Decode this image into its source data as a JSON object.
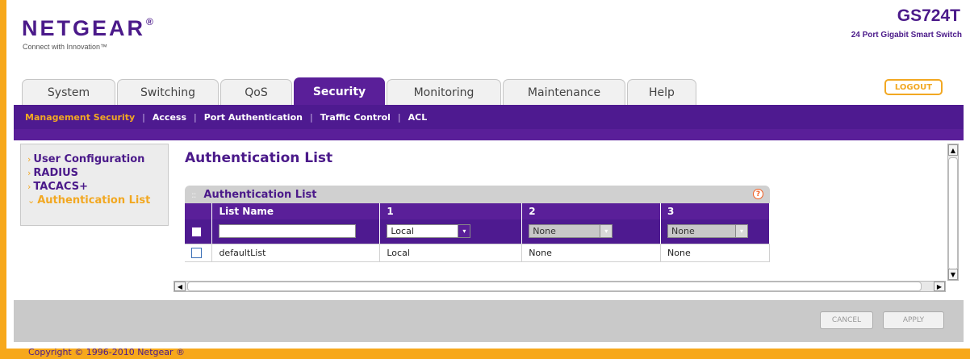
{
  "header": {
    "logo": "NETGEAR",
    "logo_mark": "®",
    "tagline": "Connect with Innovation™",
    "model": "GS724T",
    "model_desc": "24 Port Gigabit Smart Switch",
    "logout_label": "LOGOUT"
  },
  "tabs": [
    {
      "label": "System",
      "active": false
    },
    {
      "label": "Switching",
      "active": false
    },
    {
      "label": "QoS",
      "active": false
    },
    {
      "label": "Security",
      "active": true
    },
    {
      "label": "Monitoring",
      "active": false
    },
    {
      "label": "Maintenance",
      "active": false
    },
    {
      "label": "Help",
      "active": false
    }
  ],
  "subnav": [
    {
      "label": "Management Security",
      "active": true
    },
    {
      "label": "Access",
      "active": false
    },
    {
      "label": "Port Authentication",
      "active": false
    },
    {
      "label": "Traffic Control",
      "active": false
    },
    {
      "label": "ACL",
      "active": false
    }
  ],
  "sidebar": {
    "items": [
      {
        "label": "User Configuration",
        "active": false,
        "icon": "chevron-right-icon",
        "arrow": "›"
      },
      {
        "label": "RADIUS",
        "active": false,
        "icon": "chevron-right-icon",
        "arrow": "›"
      },
      {
        "label": "TACACS+",
        "active": false,
        "icon": "chevron-right-icon",
        "arrow": "›"
      },
      {
        "label": "Authentication List",
        "active": true,
        "icon": "chevron-down-icon",
        "arrow": "⌄"
      }
    ]
  },
  "main": {
    "page_title": "Authentication List",
    "panel_title": "Authentication List",
    "grip": "::",
    "help": "?",
    "columns": [
      "",
      "List Name",
      "1",
      "2",
      "3"
    ],
    "edit_row": {
      "list_name": "",
      "method1": "Local",
      "method2": "None",
      "method3": "None",
      "arrow": "▾"
    },
    "rows": [
      {
        "list_name": "defaultList",
        "method1": "Local",
        "method2": "None",
        "method3": "None"
      }
    ]
  },
  "scroll": {
    "up": "▲",
    "down": "▼",
    "left": "◀",
    "right": "▶"
  },
  "footer": {
    "cancel_label": "CANCEL",
    "apply_label": "APPLY",
    "copyright": "Copyright © 1996-2010 Netgear ®"
  },
  "colors": {
    "brand_purple": "#5a1f99",
    "accent_orange": "#f7a81b"
  }
}
